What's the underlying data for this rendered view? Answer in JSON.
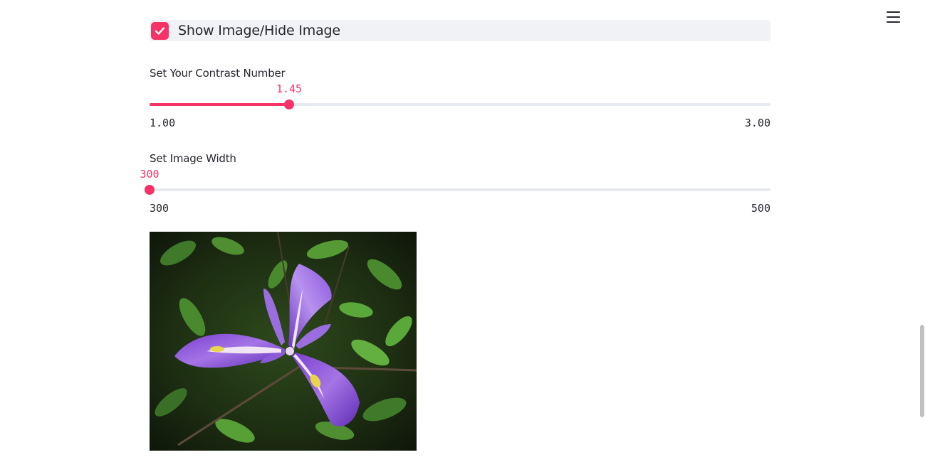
{
  "checkbox": {
    "label": "Show Image/Hide Image",
    "checked": true,
    "accent_color": "#f63366"
  },
  "contrast_slider": {
    "label": "Set Your Contrast Number",
    "value": "1.45",
    "min": "1.00",
    "max": "3.00",
    "value_fraction": 0.225
  },
  "width_slider": {
    "label": "Set Image Width",
    "value": "300",
    "min": "300",
    "max": "500",
    "value_fraction": 0.0
  },
  "image": {
    "subject": "purple-iris-flower"
  },
  "menu": {
    "icon": "hamburger-menu-icon"
  },
  "colors": {
    "accent": "#f63366",
    "track": "#e6e9ef",
    "text": "#262730",
    "checkbox_row_bg": "#f0f2f6"
  }
}
